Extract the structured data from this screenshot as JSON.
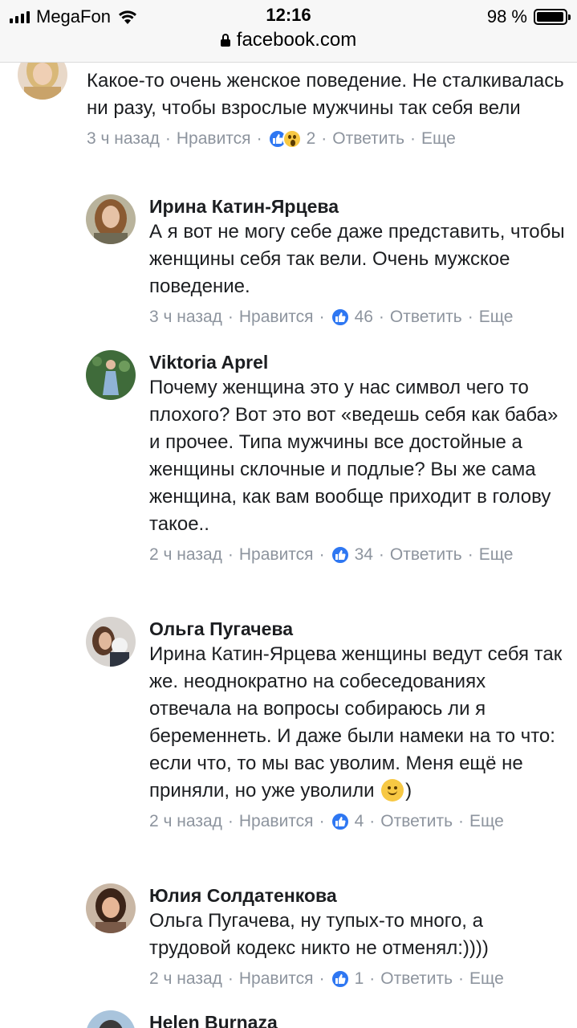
{
  "status_bar": {
    "carrier": "MegaFon",
    "time": "12:16",
    "battery_percent": "98 %",
    "battery_level": 0.98
  },
  "url_bar": {
    "domain": "facebook.com"
  },
  "actions": {
    "like": "Нравится",
    "reply": "Ответить",
    "more": "Еще"
  },
  "comments": [
    {
      "author": "",
      "text": "Какое-то очень женское поведение. Не сталкивалась ни разу, чтобы взрослые мужчины так себя вели",
      "time": "3 ч назад",
      "reactions": [
        "like-icon",
        "wow-icon"
      ],
      "reaction_count": "2"
    },
    {
      "author": "Ирина Катин-Ярцева",
      "text": "А я вот не могу себе даже представить, чтобы женщины себя так вели. Очень мужское поведение.",
      "time": "3 ч назад",
      "reactions": [
        "like-icon"
      ],
      "reaction_count": "46"
    },
    {
      "author": "Viktoria Aprel",
      "text": "Почему женщина это у нас символ чего то плохого? Вот это вот «ведешь себя как баба» и прочее. Типа мужчины все достойные а женщины склочные и подлые? Вы же сама женщина, как вам вообще приходит в голову такое..",
      "time": "2 ч назад",
      "reactions": [
        "like-icon"
      ],
      "reaction_count": "34"
    },
    {
      "author": "Ольга Пугачева",
      "text_before_emoji": "Ирина Катин-Ярцева женщины ведут себя так же. неоднократно на собеседованиях отвечала на вопросы собираюсь ли я беременнеть. И даже были намеки на то что: если что, то мы вас уволим. Меня ещё не приняли, но уже уволили ",
      "emoji": "smile-icon",
      "text_after_emoji": ")",
      "time": "2 ч назад",
      "reactions": [
        "like-icon"
      ],
      "reaction_count": "4"
    },
    {
      "author": "Юлия Солдатенкова",
      "text": "Ольга Пугачева, ну тупых-то много, а трудовой кодекс никто не отменял:))))",
      "time": "2 ч назад",
      "reactions": [
        "like-icon"
      ],
      "reaction_count": "1"
    },
    {
      "author": "Helen Burnaza",
      "text": "",
      "time": "",
      "reactions": [],
      "reaction_count": ""
    }
  ],
  "colors": {
    "like_blue": "#2e77f2",
    "meta_gray": "#8d949e",
    "text": "#1c1e21"
  }
}
